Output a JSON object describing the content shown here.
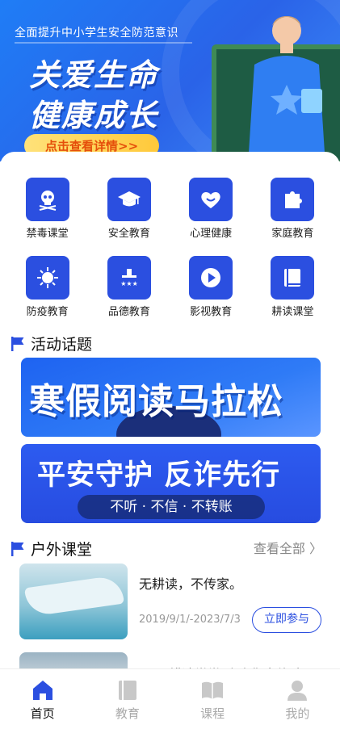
{
  "hero": {
    "subtitle": "全面提升中小学生安全防范意识",
    "line1": "关爱生命",
    "line2": "健康成长",
    "cta": "点击查看详情>>"
  },
  "categories": [
    {
      "label": "禁毒课堂",
      "icon": "skull-icon"
    },
    {
      "label": "安全教育",
      "icon": "graduation-cap-icon"
    },
    {
      "label": "心理健康",
      "icon": "heart-icon"
    },
    {
      "label": "家庭教育",
      "icon": "puzzle-icon"
    },
    {
      "label": "防疫教育",
      "icon": "virus-icon"
    },
    {
      "label": "品德教育",
      "icon": "podium-stars-icon"
    },
    {
      "label": "影视教育",
      "icon": "play-icon"
    },
    {
      "label": "耕读课堂",
      "icon": "book-icon"
    }
  ],
  "activity": {
    "title": "活动话题",
    "banner1": "寒假阅读马拉松",
    "banner2_title": "平安守护 反诈先行",
    "banner2_slogan": "不听 · 不信 · 不转账"
  },
  "outdoor": {
    "title": "户外课堂",
    "view_all": "查看全部 〉",
    "items": [
      {
        "title": "无耕读，不传家。",
        "date": "2019/9/1/-2023/7/3",
        "action": "立即参与"
      },
      {
        "title": "五一 耕读堂堂 欢迎您来体验"
      }
    ]
  },
  "tabs": [
    {
      "label": "首页",
      "icon": "home-icon",
      "active": true
    },
    {
      "label": "教育",
      "icon": "education-icon",
      "active": false
    },
    {
      "label": "课程",
      "icon": "course-icon",
      "active": false
    },
    {
      "label": "我的",
      "icon": "profile-icon",
      "active": false
    }
  ],
  "colors": {
    "primary": "#2b4fe0",
    "inactive": "#aaaaaa"
  }
}
